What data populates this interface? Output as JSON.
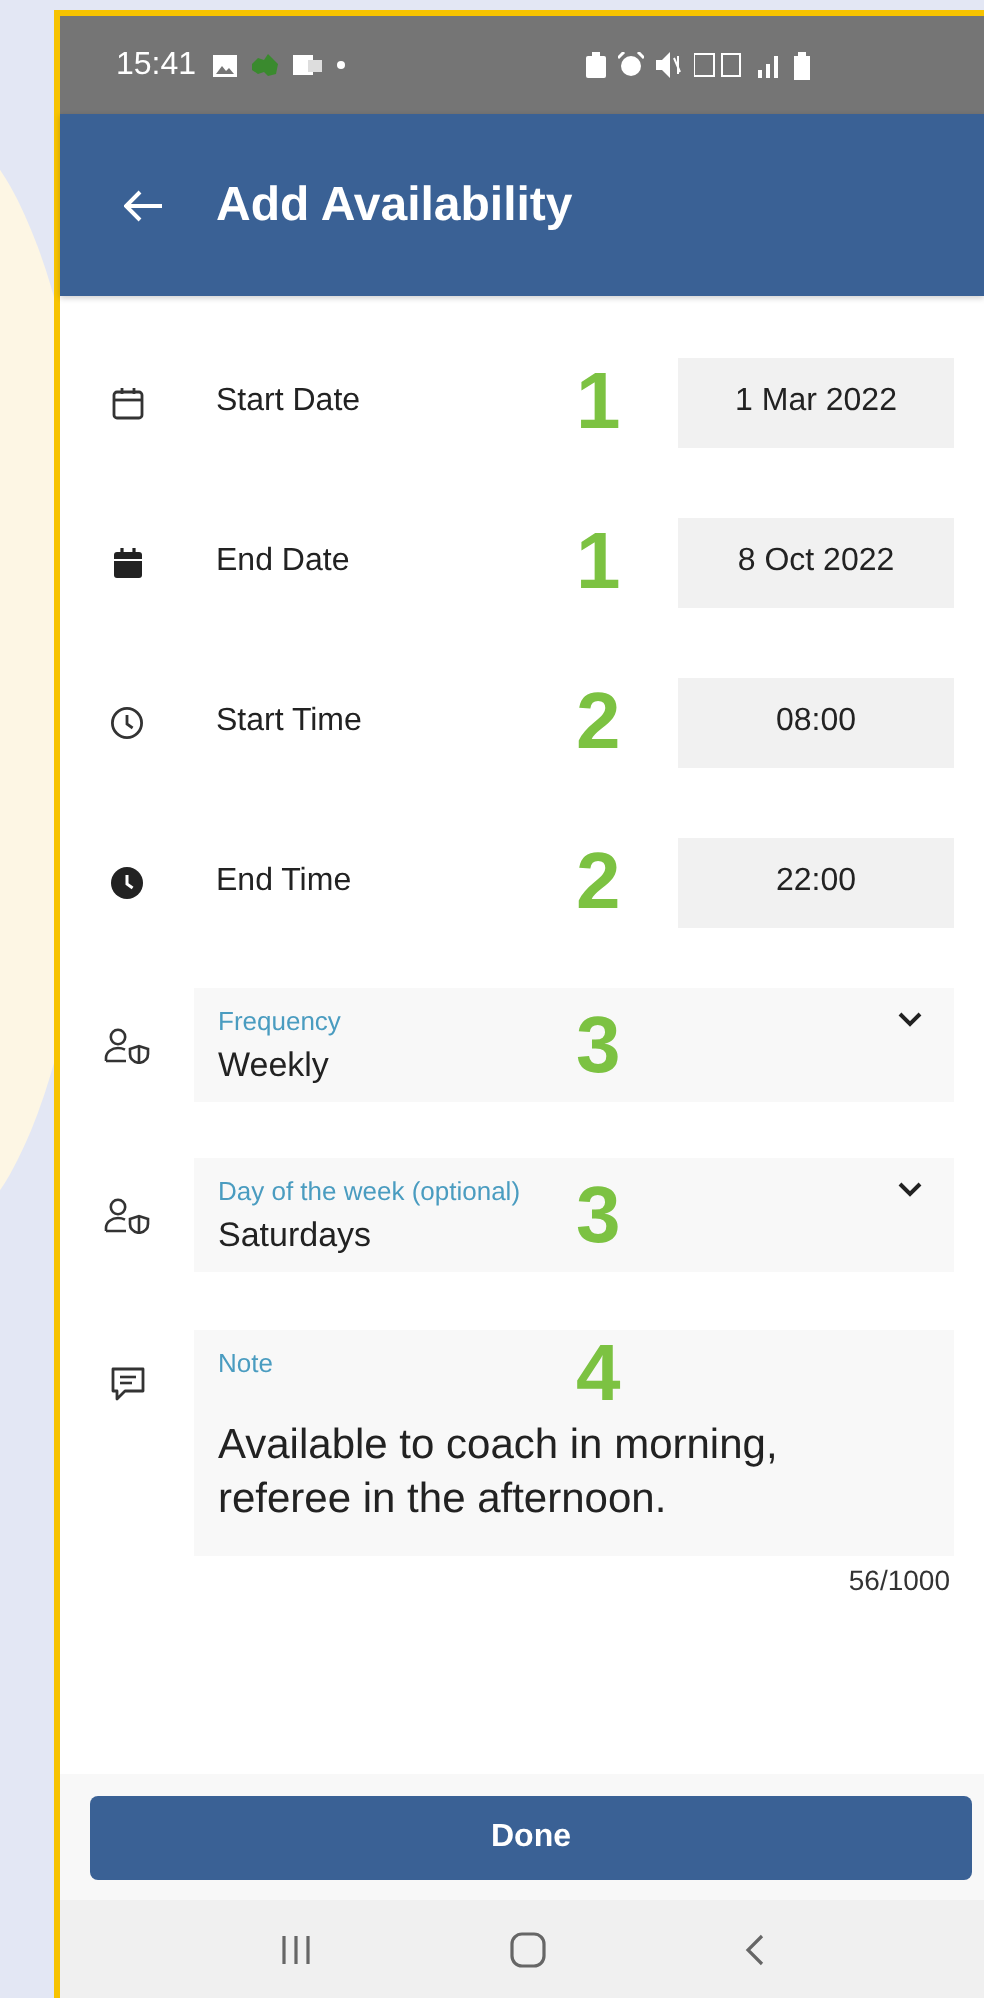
{
  "status_bar": {
    "time": "15:41"
  },
  "app_bar": {
    "title": "Add Availability"
  },
  "fields": [
    {
      "kind": "picker",
      "label": "Start Date",
      "value": "1 Mar 2022",
      "annotation": "1"
    },
    {
      "kind": "picker",
      "label": "End Date",
      "value": "8 Oct 2022",
      "annotation": "1"
    },
    {
      "kind": "picker",
      "label": "Start Time",
      "value": "08:00",
      "annotation": "2"
    },
    {
      "kind": "picker",
      "label": "End Time",
      "value": "22:00",
      "annotation": "2"
    },
    {
      "kind": "dropdown",
      "label": "Frequency",
      "value": "Weekly",
      "annotation": "3"
    },
    {
      "kind": "dropdown",
      "label": "Day of the week (optional)",
      "value": "Saturdays",
      "annotation": "3"
    },
    {
      "kind": "note",
      "label": "Note",
      "value": "Available to coach in morning, referee in the afternoon.",
      "annotation": "4",
      "counter": "56/1000"
    }
  ],
  "done_button": "Done"
}
